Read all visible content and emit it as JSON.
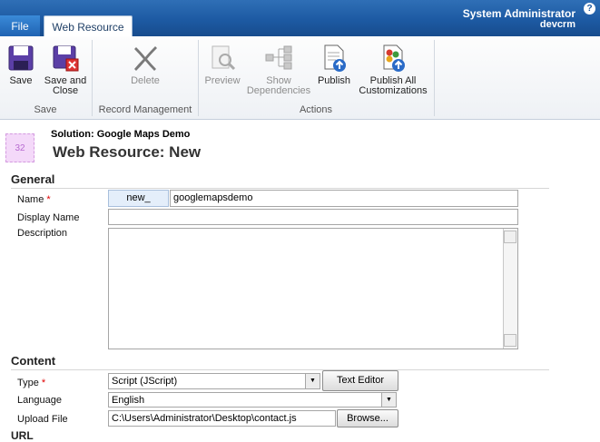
{
  "tabs": {
    "file": "File",
    "web_resource": "Web Resource"
  },
  "user": {
    "name": "System Administrator",
    "org": "devcrm",
    "help": "?"
  },
  "ribbon": {
    "save": "Save",
    "save_close_1": "Save and",
    "save_close_2": "Close",
    "delete": "Delete",
    "preview": "Preview",
    "show_dep_1": "Show",
    "show_dep_2": "Dependencies",
    "publish": "Publish",
    "publish_all_1": "Publish All",
    "publish_all_2": "Customizations",
    "group_save": "Save",
    "group_record": "Record Management",
    "group_actions": "Actions"
  },
  "header": {
    "icon_text": "32",
    "solution": "Solution: Google Maps Demo",
    "title": "Web Resource: New"
  },
  "general": {
    "section": "General",
    "name_label": "Name",
    "required_mark": "*",
    "name_prefix": "new_",
    "name_value": "googlemapsdemo",
    "display_name_label": "Display Name",
    "display_name_value": "",
    "description_label": "Description",
    "description_value": ""
  },
  "content": {
    "section": "Content",
    "type_label": "Type",
    "type_value": "Script (JScript)",
    "text_editor": "Text Editor",
    "language_label": "Language",
    "language_value": "English",
    "upload_label": "Upload File",
    "upload_value": "C:\\Users\\Administrator\\Desktop\\contact.js",
    "browse": "Browse...",
    "url_label": "URL"
  },
  "colors": {
    "topbar": "#1d5aa3",
    "required": "#e00000",
    "prefix_bg": "#e4eefa"
  }
}
